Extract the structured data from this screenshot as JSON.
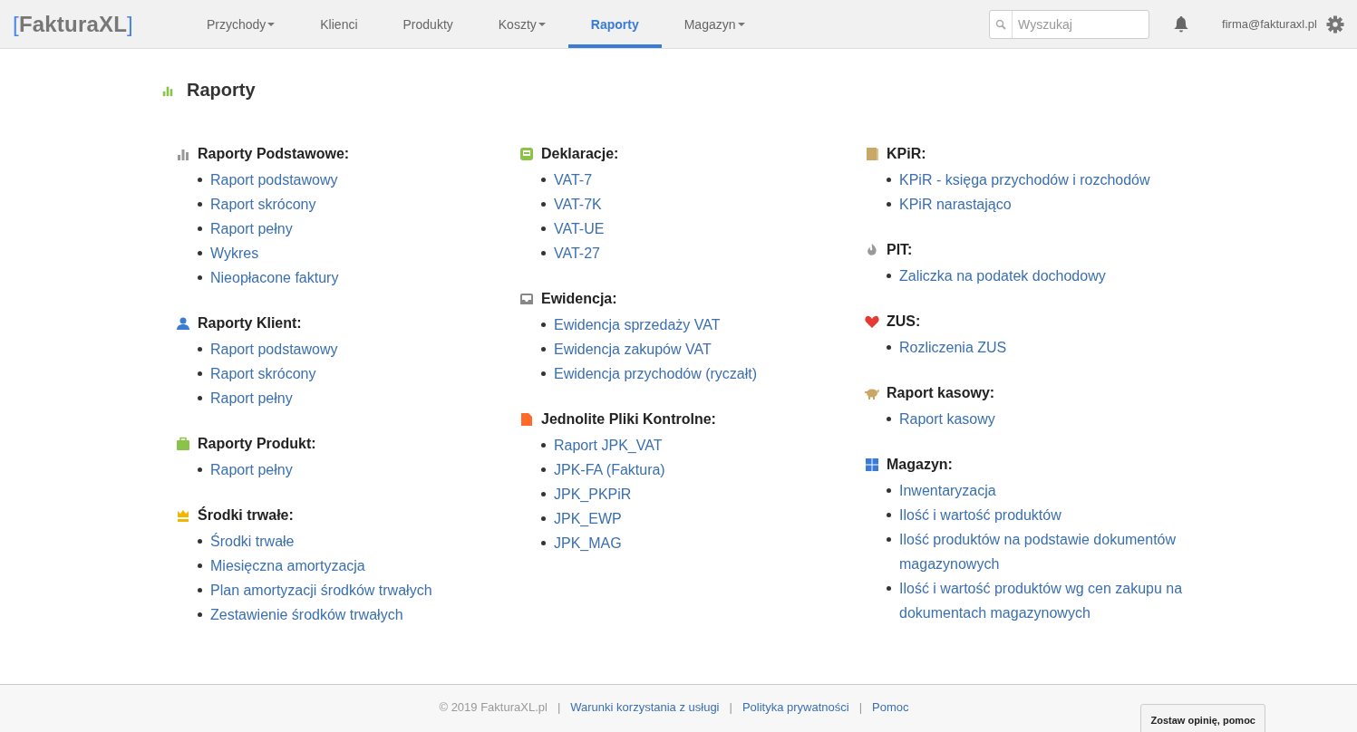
{
  "logo": {
    "bracket_open": "[",
    "name": "FakturaXL",
    "bracket_close": "]"
  },
  "nav": [
    {
      "label": "Przychody",
      "dropdown": true,
      "selected": false
    },
    {
      "label": "Klienci",
      "dropdown": false,
      "selected": false
    },
    {
      "label": "Produkty",
      "dropdown": false,
      "selected": false
    },
    {
      "label": "Koszty",
      "dropdown": true,
      "selected": false
    },
    {
      "label": "Raporty",
      "dropdown": false,
      "selected": true
    },
    {
      "label": "Magazyn",
      "dropdown": true,
      "selected": false
    }
  ],
  "search": {
    "placeholder": "Wyszukaj"
  },
  "user": "firma@fakturaxl.pl",
  "page_title": "Raporty",
  "columns": [
    [
      {
        "title": "Raporty Podstawowe:",
        "links": [
          "Raport podstawowy",
          "Raport skrócony",
          "Raport pełny",
          "Wykres",
          "Nieopłacone faktury"
        ]
      },
      {
        "title": "Raporty Klient:",
        "links": [
          "Raport podstawowy",
          "Raport skrócony",
          "Raport pełny"
        ]
      },
      {
        "title": "Raporty Produkt:",
        "links": [
          "Raport pełny"
        ]
      },
      {
        "title": "Środki trwałe:",
        "links": [
          "Środki trwałe",
          "Miesięczna amortyzacja",
          "Plan amortyzacji środków trwałych",
          "Zestawienie środków trwałych"
        ]
      }
    ],
    [
      {
        "title": "Deklaracje:",
        "links": [
          "VAT-7",
          "VAT-7K",
          "VAT-UE",
          "VAT-27"
        ]
      },
      {
        "title": "Ewidencja:",
        "links": [
          "Ewidencja sprzedaży VAT",
          "Ewidencja zakupów VAT",
          "Ewidencja przychodów (ryczałt)"
        ]
      },
      {
        "title": "Jednolite Pliki Kontrolne:",
        "links": [
          "Raport JPK_VAT",
          "JPK-FA (Faktura)",
          "JPK_PKPiR",
          "JPK_EWP",
          "JPK_MAG"
        ]
      }
    ],
    [
      {
        "title": "KPiR:",
        "links": [
          "KPiR - księga przychodów i rozchodów",
          "KPiR narastająco"
        ]
      },
      {
        "title": "PIT:",
        "links": [
          "Zaliczka na podatek dochodowy"
        ]
      },
      {
        "title": "ZUS:",
        "links": [
          "Rozliczenia ZUS"
        ]
      },
      {
        "title": "Raport kasowy:",
        "links": [
          "Raport kasowy"
        ]
      },
      {
        "title": "Magazyn:",
        "links": [
          "Inwentaryzacja",
          "Ilość i wartość produktów",
          "Ilość produktów na podstawie dokumentów magazynowych",
          "Ilość i wartość produktów wg cen zakupu na dokumentach magazynowych"
        ]
      }
    ]
  ],
  "footer": {
    "copyright": "© 2019 FakturaXL.pl",
    "separator": "|",
    "links": [
      "Warunki korzystania z usługi",
      "Polityka prywatności",
      "Pomoc"
    ]
  },
  "feedback_button": "Zostaw opinię, pomoc"
}
